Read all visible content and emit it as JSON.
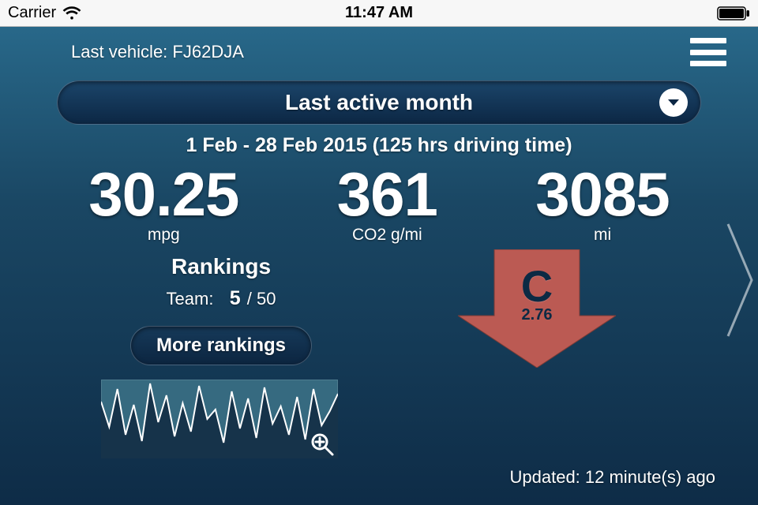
{
  "status": {
    "carrier": "Carrier",
    "time": "11:47 AM"
  },
  "header": {
    "last_vehicle_label": "Last vehicle:",
    "last_vehicle_id": "FJ62DJA"
  },
  "period": {
    "selected_label": "Last active month",
    "date_range": "1 Feb - 28 Feb 2015 (125 hrs driving time)"
  },
  "stats": {
    "mpg": {
      "value": "30.25",
      "unit": "mpg"
    },
    "co2": {
      "value": "361",
      "unit": "CO2 g/mi"
    },
    "dist": {
      "value": "3085",
      "unit": "mi"
    }
  },
  "rankings": {
    "title": "Rankings",
    "team_label": "Team:",
    "team_position": "5",
    "team_separator": "/",
    "team_total": "50",
    "more_button": "More rankings"
  },
  "grade": {
    "letter": "C",
    "score": "2.76"
  },
  "footer": {
    "updated": "Updated: 12 minute(s) ago"
  },
  "chart_data": {
    "type": "line",
    "title": "",
    "xlabel": "",
    "ylabel": "",
    "ylim": [
      0,
      100
    ],
    "x": [
      0,
      1,
      2,
      3,
      4,
      5,
      6,
      7,
      8,
      9,
      10,
      11,
      12,
      13,
      14,
      15,
      16,
      17,
      18,
      19,
      20,
      21,
      22,
      23,
      24,
      25,
      26,
      27,
      28,
      29
    ],
    "values": [
      72,
      40,
      88,
      30,
      68,
      22,
      95,
      46,
      80,
      28,
      70,
      34,
      92,
      50,
      62,
      20,
      85,
      38,
      76,
      26,
      90,
      44,
      66,
      30,
      78,
      24,
      88,
      42,
      60,
      82
    ]
  }
}
